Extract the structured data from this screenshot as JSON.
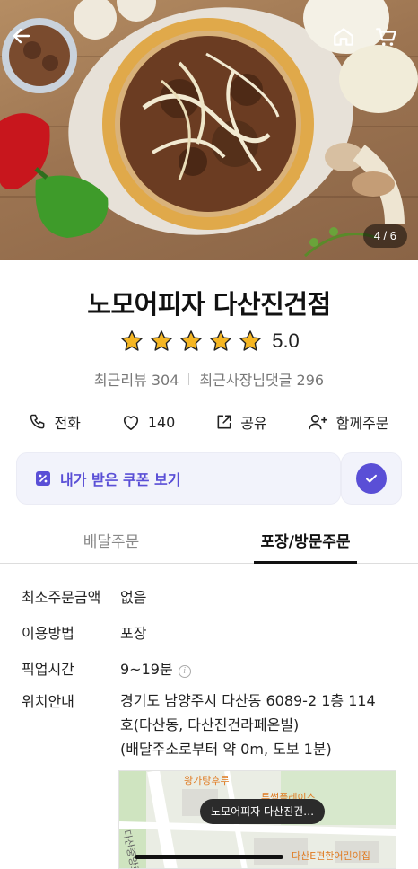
{
  "hero": {
    "image_counter": "4 / 6",
    "back_icon": "arrow-left-icon",
    "home_icon": "home-icon",
    "cart_icon": "cart-icon"
  },
  "store": {
    "name": "노모어피자 다산진건점",
    "rating": "5.0",
    "rating_stars": 5,
    "recent_reviews": "최근리뷰 304",
    "recent_owner_replies": "최근사장님댓글 296"
  },
  "actions": {
    "call": "전화",
    "likes": "140",
    "share": "공유",
    "group_order": "함께주문"
  },
  "coupon": {
    "label": "내가 받은 쿠폰 보기"
  },
  "tabs": {
    "delivery": "배달주문",
    "pickup": "포장/방문주문",
    "active": "pickup"
  },
  "info": {
    "min_order_label": "최소주문금액",
    "min_order_value": "없음",
    "method_label": "이용방법",
    "method_value": "포장",
    "pickup_time_label": "픽업시간",
    "pickup_time_value": "9~19분",
    "location_label": "위치안내",
    "address_line1": "경기도 남양주시 다산동 6089-2 1층 114",
    "address_line2": "호(다산동, 다산진건라페온빌)",
    "address_line3": "(배달주소로부터 약 0m, 도보 1분)"
  },
  "map": {
    "store_bubble": "노모어피자 다산진건…",
    "poi_1": "왕가탕후루",
    "poi_2": "투썸플레이스",
    "poi_3": "다산E편한어린이집",
    "road_label": "다산중앙로1"
  },
  "colors": {
    "accent": "#5a4fd6",
    "star": "#f5b623",
    "map_poi": "#e07b22"
  }
}
